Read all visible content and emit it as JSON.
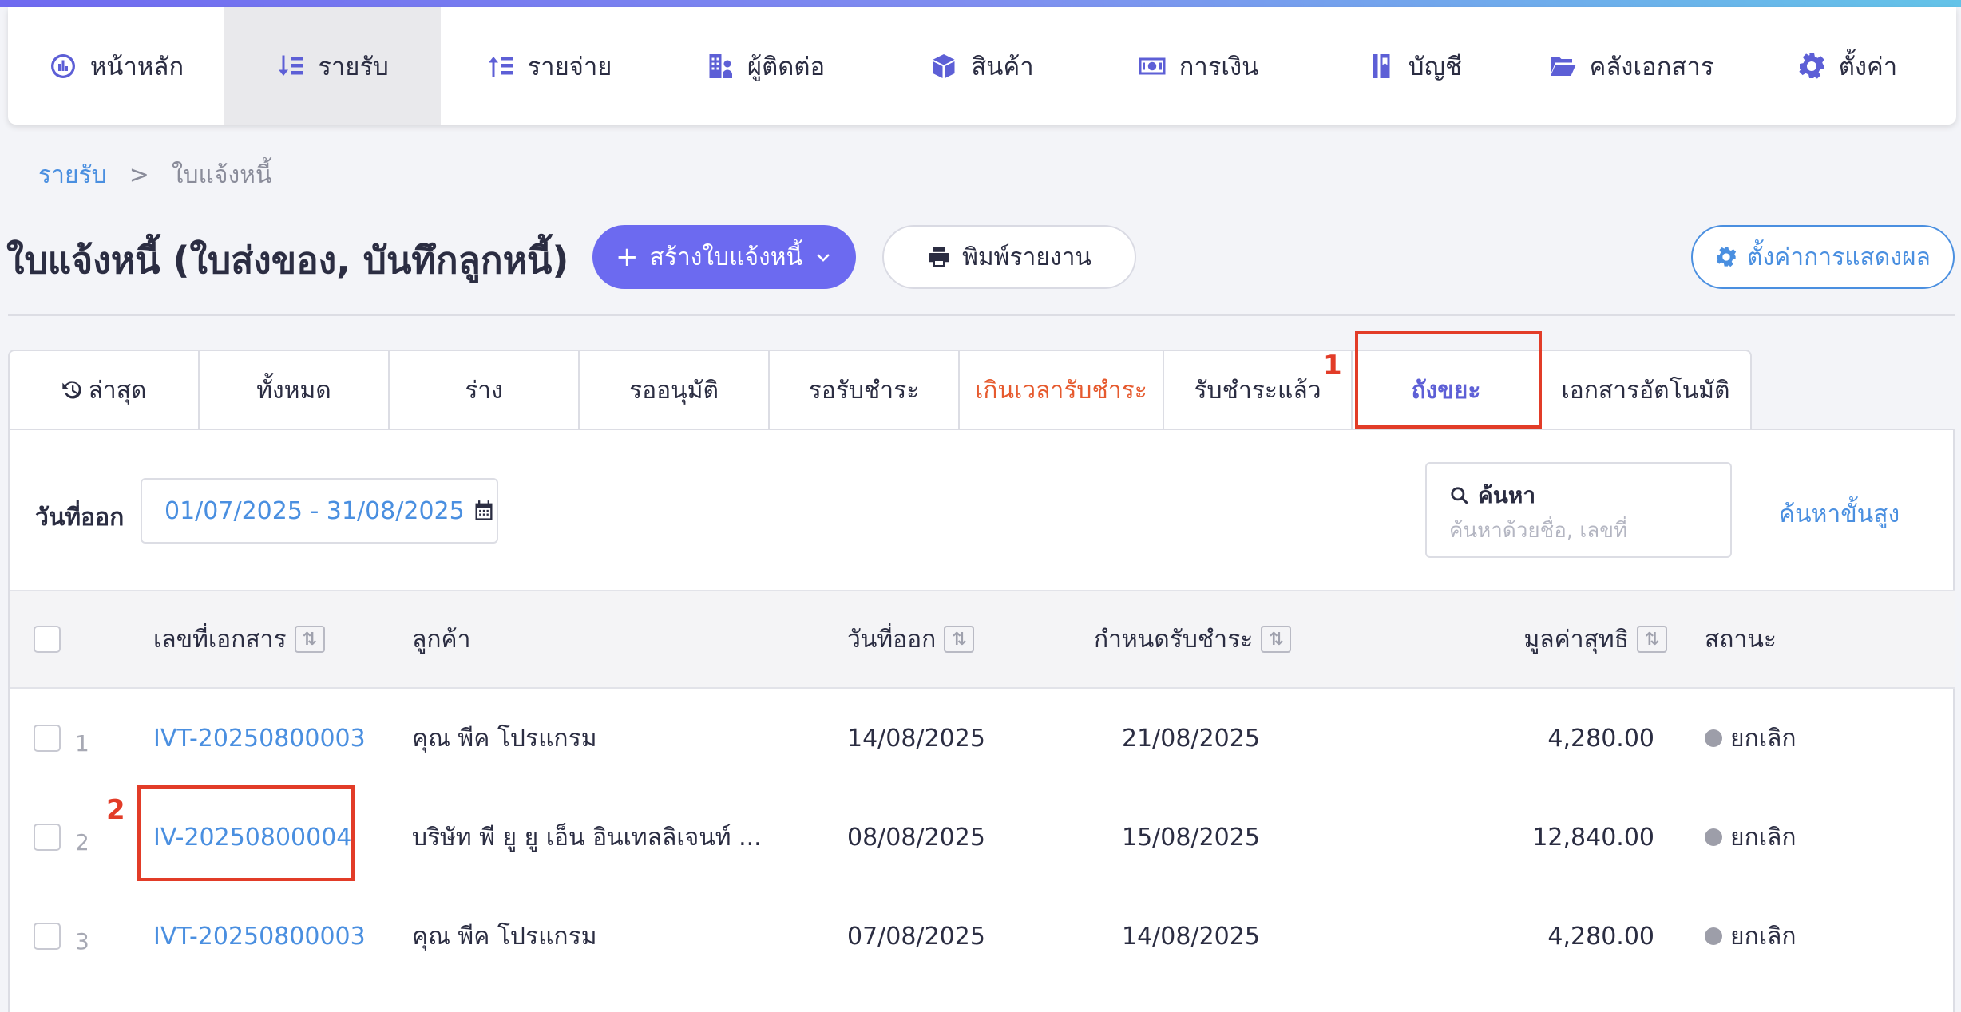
{
  "nav": [
    {
      "label": "หน้าหลัก",
      "icon": "dashboard-icon",
      "active": false
    },
    {
      "label": "รายรับ",
      "icon": "income-icon",
      "active": true
    },
    {
      "label": "รายจ่าย",
      "icon": "expense-icon",
      "active": false
    },
    {
      "label": "ผู้ติดต่อ",
      "icon": "contacts-icon",
      "active": false
    },
    {
      "label": "สินค้า",
      "icon": "box-icon",
      "active": false
    },
    {
      "label": "การเงิน",
      "icon": "money-icon",
      "active": false
    },
    {
      "label": "บัญชี",
      "icon": "ledger-icon",
      "active": false
    },
    {
      "label": "คลังเอกสาร",
      "icon": "folder-icon",
      "active": false
    },
    {
      "label": "ตั้งค่า",
      "icon": "gear-icon",
      "active": false
    }
  ],
  "breadcrumb": {
    "parent": "รายรับ",
    "separator": ">",
    "current": "ใบแจ้งหนี้"
  },
  "page": {
    "title": "ใบแจ้งหนี้ (ใบส่งของ, บันทึกลูกหนี้)",
    "create_label": "สร้างใบแจ้งหนี้",
    "print_label": "พิมพ์รายงาน",
    "display_settings_label": "ตั้งค่าการแสดงผล"
  },
  "tabs": [
    {
      "label": "ล่าสุด",
      "icon": "history-icon"
    },
    {
      "label": "ทั้งหมด"
    },
    {
      "label": "ร่าง"
    },
    {
      "label": "รออนุมัติ"
    },
    {
      "label": "รอรับชำระ"
    },
    {
      "label": "เกินเวลารับชำระ"
    },
    {
      "label": "รับชำระแล้ว"
    },
    {
      "label": "ถังขยะ",
      "active": true
    },
    {
      "label": "เอกสารอัตโนมัติ"
    }
  ],
  "annotations": {
    "tab_marker": "1",
    "doc_marker": "2"
  },
  "filter": {
    "date_label": "วันที่ออก",
    "date_range": "01/07/2025 - 31/08/2025",
    "search_label": "ค้นหา",
    "search_placeholder": "ค้นหาด้วยชื่อ, เลขที่",
    "advanced_label": "ค้นหาขั้นสูง"
  },
  "table": {
    "headers": {
      "doc_no": "เลขที่เอกสาร",
      "customer": "ลูกค้า",
      "issue_date": "วันที่ออก",
      "due_date": "กำหนดรับชำระ",
      "net_amount": "มูลค่าสุทธิ",
      "status": "สถานะ"
    },
    "rows": [
      {
        "num": "1",
        "doc_no": "IVT-20250800003",
        "customer": "คุณ พีค โปรแกรม",
        "issue_date": "14/08/2025",
        "due_date": "21/08/2025",
        "net_amount": "4,280.00",
        "status": "ยกเลิก"
      },
      {
        "num": "2",
        "doc_no": "IV-20250800004",
        "customer": "บริษัท พี ยู ยู เอ็น อินเทลลิเจนท์ ...",
        "issue_date": "08/08/2025",
        "due_date": "15/08/2025",
        "net_amount": "12,840.00",
        "status": "ยกเลิก"
      },
      {
        "num": "3",
        "doc_no": "IVT-20250800003",
        "customer": "คุณ พีค โปรแกรม",
        "issue_date": "07/08/2025",
        "due_date": "14/08/2025",
        "net_amount": "4,280.00",
        "status": "ยกเลิก"
      }
    ]
  },
  "colors": {
    "accent": "#6c6af0",
    "link": "#4a8fe0",
    "overdue": "#e65a2e",
    "annotation": "#e23c28"
  }
}
